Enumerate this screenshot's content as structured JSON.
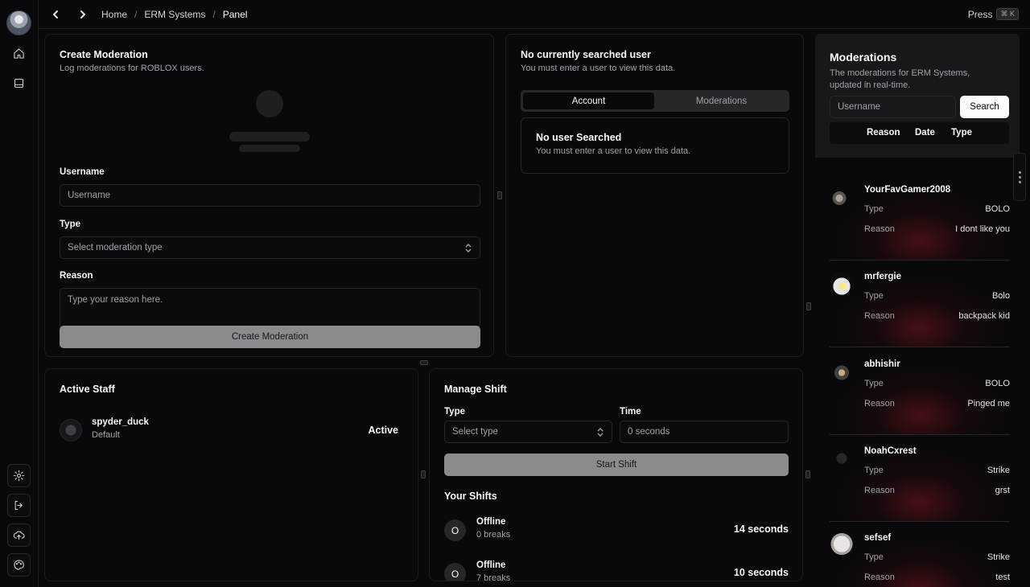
{
  "breadcrumbs": [
    "Home",
    "ERM Systems",
    "Panel"
  ],
  "command": {
    "press_label": "Press",
    "shortcut": "⌘ K"
  },
  "create_moderation": {
    "title": "Create Moderation",
    "subtitle": "Log moderations for ROBLOX users.",
    "username_label": "Username",
    "username_placeholder": "Username",
    "type_label": "Type",
    "type_placeholder": "Select moderation type",
    "reason_label": "Reason",
    "reason_placeholder": "Type your reason here.",
    "submit_label": "Create Moderation"
  },
  "searched_user": {
    "title": "No currently searched user",
    "subtitle": "You must enter a user to view this data.",
    "tabs": [
      {
        "label": "Account",
        "active": true
      },
      {
        "label": "Moderations",
        "active": false
      }
    ],
    "empty_title": "No user Searched",
    "empty_subtitle": "You must enter a user to view this data."
  },
  "active_staff": {
    "title": "Active Staff",
    "members": [
      {
        "name": "spyder_duck",
        "role": "Default",
        "status": "Active"
      }
    ]
  },
  "manage_shift": {
    "title": "Manage Shift",
    "type_label": "Type",
    "type_placeholder": "Select type",
    "time_label": "Time",
    "time_value": "0 seconds",
    "start_label": "Start Shift",
    "your_shifts_title": "Your Shifts",
    "shifts": [
      {
        "initial": "O",
        "status": "Offline",
        "breaks": "0 breaks",
        "duration": "14 seconds"
      },
      {
        "initial": "O",
        "status": "Offline",
        "breaks": "7 breaks",
        "duration": "10 seconds"
      }
    ]
  },
  "moderations": {
    "title": "Moderations",
    "subtitle_1": "The moderations for ERM Systems,",
    "subtitle_2": "updated in real-time.",
    "search_placeholder": "Username",
    "search_label": "Search",
    "columns": [
      "Reason",
      "Date",
      "Type"
    ],
    "type_key": "Type",
    "reason_key": "Reason",
    "items": [
      {
        "user": "YourFavGamer2008",
        "type": "BOLO",
        "reason": "I dont like you"
      },
      {
        "user": "mrfergie",
        "type": "Bolo",
        "reason": "backpack kid"
      },
      {
        "user": "abhishir",
        "type": "BOLO",
        "reason": "Pinged me"
      },
      {
        "user": "NoahCxrest",
        "type": "Strike",
        "reason": "grst"
      },
      {
        "user": "sefsef",
        "type": "Strike",
        "reason": "test"
      }
    ]
  },
  "colors": {
    "background": "#09090b",
    "panel_border": "#1c1c20",
    "accent_red": "#78141c",
    "button_gray": "#8a8a8f"
  }
}
